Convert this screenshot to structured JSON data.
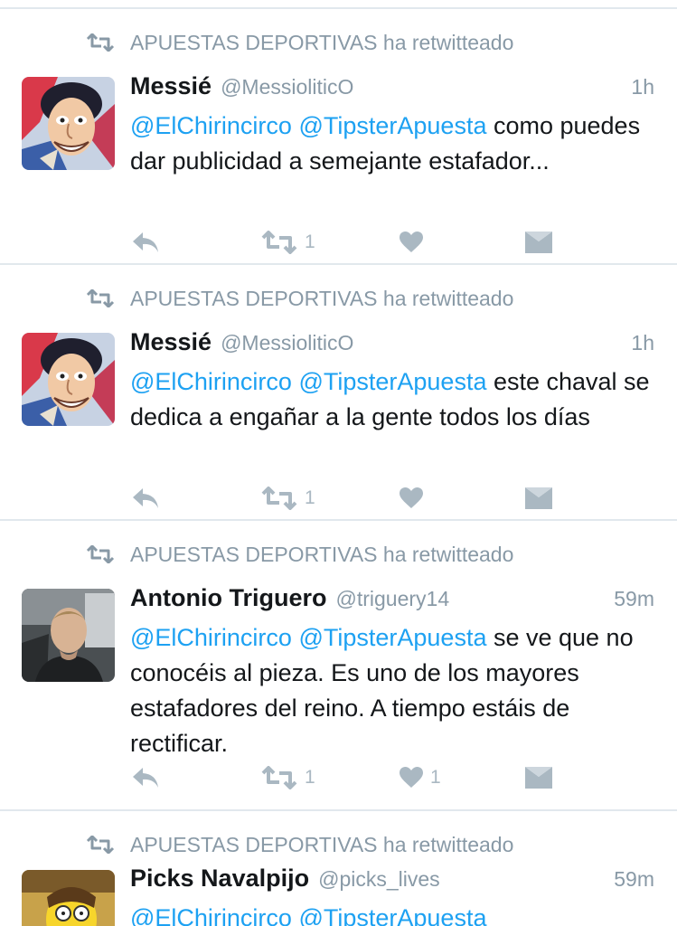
{
  "tweets": [
    {
      "retweet_context": "APUESTAS DEPORTIVAS ha retwitteado",
      "name": "Messié",
      "handle": "@MessioliticO",
      "time": "1h",
      "mention1": "@ElChirincirco",
      "mention2": "@TipsterApuesta",
      "body": " como puedes dar publicidad a semejante estafador...",
      "retweet_count": "1",
      "like_count": "",
      "avatar": "caricature"
    },
    {
      "retweet_context": "APUESTAS DEPORTIVAS ha retwitteado",
      "name": "Messié",
      "handle": "@MessioliticO",
      "time": "1h",
      "mention1": "@ElChirincirco",
      "mention2": "@TipsterApuesta",
      "body": " este chaval se dedica a engañar a la gente todos los días",
      "retweet_count": "1",
      "like_count": "",
      "avatar": "caricature"
    },
    {
      "retweet_context": "APUESTAS DEPORTIVAS ha retwitteado",
      "name": "Antonio Triguero",
      "handle": "@triguery14",
      "time": "59m",
      "mention1": "@ElChirincirco",
      "mention2": "@TipsterApuesta",
      "body": " se ve que no conocéis al pieza. Es uno de los mayores estafadores del reino. A tiempo estáis de rectificar.",
      "retweet_count": "1",
      "like_count": "1",
      "avatar": "photo"
    },
    {
      "retweet_context": "APUESTAS DEPORTIVAS ha retwitteado",
      "name": "Picks Navalpijo",
      "handle": "@picks_lives",
      "time": "59m",
      "mention1": "@ElChirincirco",
      "mention2": "@TipsterApuesta",
      "body": "",
      "retweet_count": "",
      "like_count": "",
      "avatar": "cartoon"
    }
  ],
  "icons": {
    "retweet_context": "retweet-icon",
    "reply": "reply-icon",
    "retweet": "retweet-icon",
    "like": "heart-icon",
    "message": "envelope-icon"
  },
  "colors": {
    "mention": "#1da1f2",
    "secondary_text": "#8899a6",
    "action_icon": "#aab8c2",
    "divider": "#e1e8ed"
  }
}
